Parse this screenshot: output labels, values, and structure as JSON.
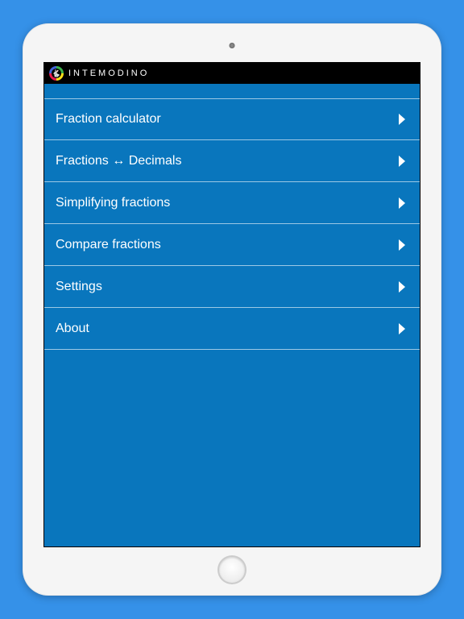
{
  "header": {
    "brand": "INTEMODINO",
    "logo_glyph": "🐇"
  },
  "menu": {
    "items": [
      {
        "label": "Fraction calculator"
      },
      {
        "label": "Fractions ↔ Decimals"
      },
      {
        "label": "Simplifying fractions"
      },
      {
        "label": "Compare fractions"
      },
      {
        "label": "Settings"
      },
      {
        "label": "About"
      }
    ]
  }
}
